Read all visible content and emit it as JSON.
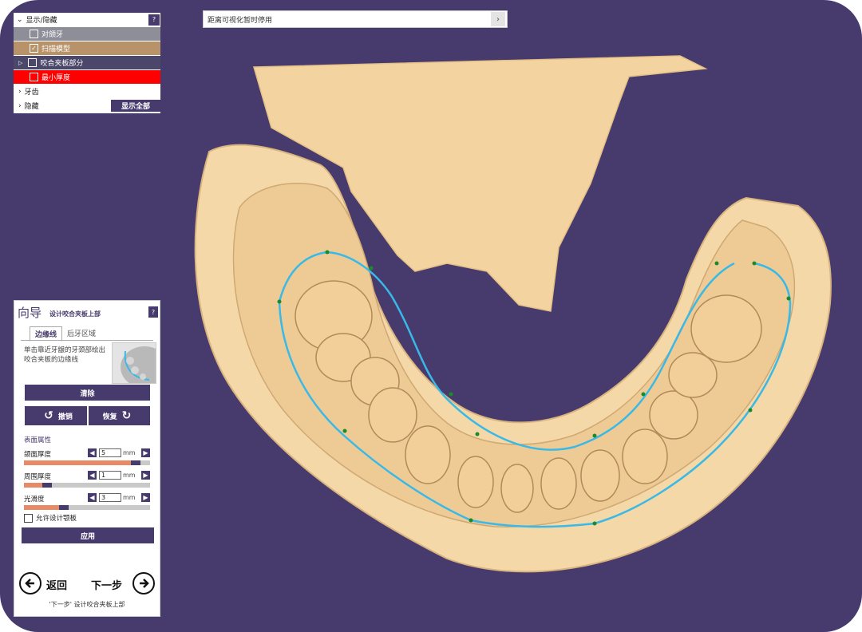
{
  "info_bar": {
    "text": "距离可视化暂时停用",
    "arrow_icon": "chevron-right-icon"
  },
  "layers": {
    "header": "显示/隐藏",
    "help": "?",
    "items": [
      {
        "label": "对颌牙",
        "checked": false
      },
      {
        "label": "扫描模型",
        "checked": true
      },
      {
        "label": "咬合夹板部分",
        "checked": false
      },
      {
        "label": "最小厚度",
        "checked": false
      }
    ],
    "teeth": "牙齿",
    "hidden": "隐藏",
    "show_all": "显示全部",
    "colors": {
      "antagonist": "#8e8e99",
      "scan": "#b8936a",
      "occlusal": "#4b476a",
      "min": "#ff0000"
    }
  },
  "wizard": {
    "title": "向导",
    "subtitle": "设计咬合夹板上部",
    "help": "?",
    "tabs": [
      "边缘线",
      "后牙区域"
    ],
    "active_tab": "边缘线",
    "instructions": "单击靠近牙龈的牙颈部绘出咬合夹板的边缘线",
    "clear": "清除",
    "undo": "撤销",
    "redo": "恢复",
    "section": "表面属性",
    "params": [
      {
        "label": "颌面厚度",
        "value": "5",
        "unit": "mm",
        "level": 0.92
      },
      {
        "label": "周围厚度",
        "value": "1",
        "unit": "mm",
        "level": 0.16
      },
      {
        "label": "光滑度",
        "value": "3",
        "unit": "mm",
        "level": 0.3
      }
    ],
    "allow": "允许设计颚板",
    "apply": "应用",
    "back": "返回",
    "next": "下一步",
    "footer": "'下一步' 设计咬合夹板上部"
  },
  "scene": {
    "background": "#473a6c",
    "model_color": "#f5d8a7",
    "margin_line_color": "#38b9e8"
  }
}
